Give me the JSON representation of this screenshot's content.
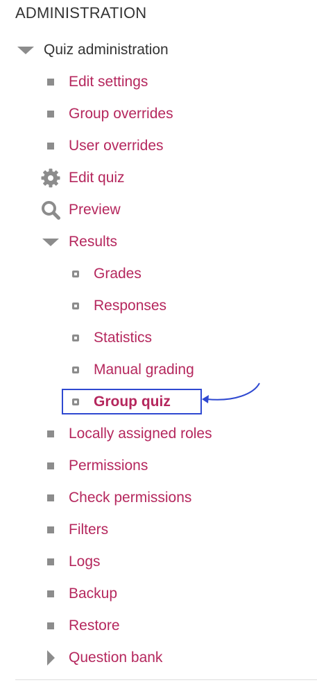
{
  "block": {
    "title": "ADMINISTRATION"
  },
  "quiz_admin": {
    "label": "Quiz administration",
    "expanded": true,
    "items": [
      {
        "label": "Edit settings",
        "icon": "bullet-square"
      },
      {
        "label": "Group overrides",
        "icon": "bullet-square"
      },
      {
        "label": "User overrides",
        "icon": "bullet-square"
      },
      {
        "label": "Edit quiz",
        "icon": "gear-icon"
      },
      {
        "label": "Preview",
        "icon": "magnifier-icon"
      }
    ],
    "results": {
      "label": "Results",
      "expanded": true,
      "items": [
        {
          "label": "Grades"
        },
        {
          "label": "Responses"
        },
        {
          "label": "Statistics"
        },
        {
          "label": "Manual grading"
        },
        {
          "label": "Group quiz",
          "highlighted": true
        }
      ]
    },
    "more_items": [
      {
        "label": "Locally assigned roles"
      },
      {
        "label": "Permissions"
      },
      {
        "label": "Check permissions"
      },
      {
        "label": "Filters"
      },
      {
        "label": "Logs"
      },
      {
        "label": "Backup"
      },
      {
        "label": "Restore"
      }
    ],
    "question_bank": {
      "label": "Question bank",
      "expanded": false
    }
  },
  "colors": {
    "link": "#b5275d",
    "text": "#333333",
    "icon": "#8c8c8c",
    "annotation": "#2f49d1"
  }
}
